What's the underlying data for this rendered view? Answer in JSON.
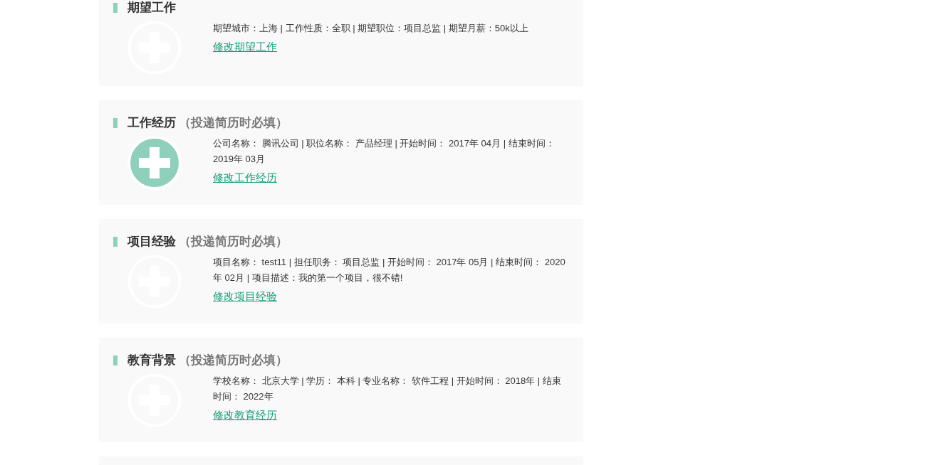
{
  "sections": [
    {
      "title": "期望工作",
      "active": false,
      "details": [
        "期望城市：上海 | 工作性质：全职 | 期望职位：项目总监 | 期望月薪：50k以上"
      ],
      "link": "修改期望工作"
    },
    {
      "title": "工作经历",
      "note": "（投递简历时必填）",
      "active": true,
      "details": [
        "公司名称： 腾讯公司 | 职位名称： 产品经理 | 开始时间： 2017年 04月 | 结束时间： 2019年 03月"
      ],
      "link": "修改工作经历"
    },
    {
      "title": "项目经验",
      "note": "（投递简历时必填）",
      "active": false,
      "details": [
        "项目名称： test11 | 担任职务： 项目总监 | 开始时间： 2017年 05月 | 结束时间： 2020年 02月 | 项目描述：我的第一个项目，很不错!"
      ],
      "link": "修改项目经验"
    },
    {
      "title": "教育背景",
      "note": "（投递简历时必填）",
      "active": false,
      "details": [
        "学校名称： 北京大学 | 学历： 本科 | 专业名称： 软件工程 | 开始时间： 2018年 | 结束时间： 2022年"
      ],
      "link": "修改教育经历"
    }
  ]
}
